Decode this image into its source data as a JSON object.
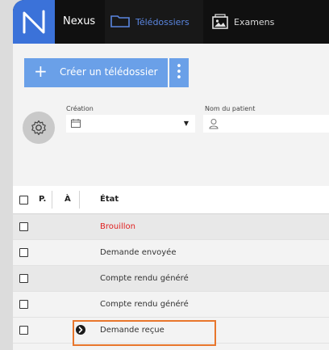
{
  "nav": {
    "brand": "Nexus",
    "tabs": [
      {
        "label": "Télédossiers",
        "icon": "folder-icon",
        "active": true
      },
      {
        "label": "Examens",
        "icon": "image-icon",
        "active": false
      }
    ]
  },
  "actions": {
    "create_label": "Créer un télédossier",
    "create_icon": "plus-icon",
    "more_icon": "vertical-dots-icon"
  },
  "filters": {
    "creation_label": "Création",
    "creation_value": "",
    "patient_label": "Nom du patient",
    "patient_value": ""
  },
  "table": {
    "headers": [
      "P.",
      "À",
      "État"
    ],
    "rows": [
      {
        "etat": "Brouillon",
        "color": "#e02020",
        "icon": ""
      },
      {
        "etat": "Demande envoyée",
        "color": "#333333",
        "icon": ""
      },
      {
        "etat": "Compte rendu généré",
        "color": "#333333",
        "icon": ""
      },
      {
        "etat": "Compte rendu généré",
        "color": "#333333",
        "icon": ""
      },
      {
        "etat": "Demande reçue",
        "color": "#333333",
        "icon": "arrow-right-circle-icon"
      }
    ]
  },
  "colors": {
    "accent": "#6aa0e8",
    "logo_bg": "#3b72d9",
    "nav_bg": "#101010",
    "highlight": "#e8762c",
    "draft": "#e02020"
  }
}
